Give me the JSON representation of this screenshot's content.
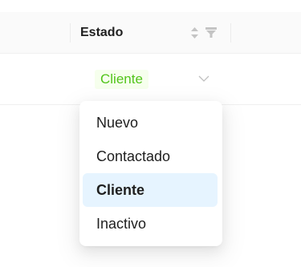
{
  "table": {
    "column_header": "Estado",
    "row": {
      "status_tag": "Cliente"
    }
  },
  "colors": {
    "tag_text": "#52c41a",
    "tag_bg": "#f6ffed",
    "selected_option_bg": "#e6f4ff"
  },
  "dropdown": {
    "options": [
      {
        "label": "Nuevo",
        "selected": false
      },
      {
        "label": "Contactado",
        "selected": false
      },
      {
        "label": "Cliente",
        "selected": true
      },
      {
        "label": "Inactivo",
        "selected": false
      }
    ]
  }
}
